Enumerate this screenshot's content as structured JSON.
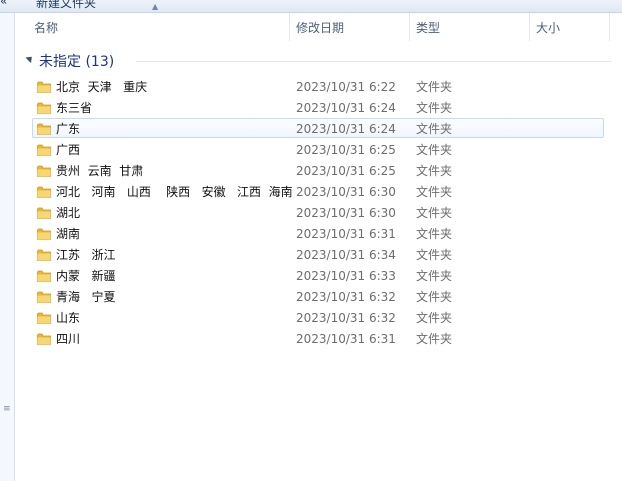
{
  "toolbar": {
    "back_glyph": "«",
    "new_folder_label": "新建文件夹"
  },
  "columns": {
    "name": "名称",
    "date": "修改日期",
    "type": "类型",
    "size": "大小"
  },
  "group": {
    "title": "未指定 (13)"
  },
  "rows": [
    {
      "name": "北京  天津   重庆",
      "date": "2023/10/31 6:22",
      "type": "文件夹"
    },
    {
      "name": "东三省",
      "date": "2023/10/31 6:24",
      "type": "文件夹"
    },
    {
      "name": "广东",
      "date": "2023/10/31 6:24",
      "type": "文件夹"
    },
    {
      "name": "广西",
      "date": "2023/10/31 6:25",
      "type": "文件夹"
    },
    {
      "name": "贵州  云南  甘肃",
      "date": "2023/10/31 6:25",
      "type": "文件夹"
    },
    {
      "name": "河北   河南   山西    陕西   安徽   江西  海南",
      "date": "2023/10/31 6:30",
      "type": "文件夹"
    },
    {
      "name": "湖北",
      "date": "2023/10/31 6:30",
      "type": "文件夹"
    },
    {
      "name": "湖南",
      "date": "2023/10/31 6:31",
      "type": "文件夹"
    },
    {
      "name": "江苏   浙江",
      "date": "2023/10/31 6:34",
      "type": "文件夹"
    },
    {
      "name": "内蒙   新疆",
      "date": "2023/10/31 6:33",
      "type": "文件夹"
    },
    {
      "name": "青海   宁夏",
      "date": "2023/10/31 6:32",
      "type": "文件夹"
    },
    {
      "name": "山东",
      "date": "2023/10/31 6:32",
      "type": "文件夹"
    },
    {
      "name": "四川",
      "date": "2023/10/31 6:31",
      "type": "文件夹"
    }
  ],
  "icons": {
    "folder": "folder-icon",
    "sort": "sort-ascending-icon",
    "group_toggle": "collapse-triangle-icon"
  },
  "colors": {
    "group_title": "#1e3287",
    "hover_border": "#c6dbf3",
    "folder_yellow": "#f2c94c"
  }
}
